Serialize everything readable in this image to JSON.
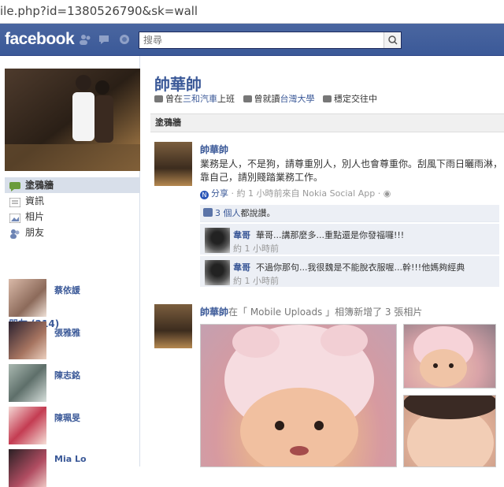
{
  "browser": {
    "url": "ile.php?id=1380526790&sk=wall"
  },
  "topbar": {
    "logo": "facebook",
    "search_placeholder": "搜尋",
    "search_value": "搜尋"
  },
  "left": {
    "nav": [
      {
        "label": "塗鴉牆",
        "icon": "wall-icon",
        "selected": true
      },
      {
        "label": "資訊",
        "icon": "info-icon",
        "selected": false
      },
      {
        "label": "相片",
        "icon": "photos-icon",
        "selected": false
      },
      {
        "label": "朋友",
        "icon": "friends-icon",
        "selected": false
      }
    ],
    "friends_heading": "朋友 (214)",
    "friends": [
      {
        "name": "蔡依諼"
      },
      {
        "name": "張雅雅"
      },
      {
        "name": "陳志銘"
      },
      {
        "name": "陳珮旻"
      },
      {
        "name": "Mia Lo"
      }
    ]
  },
  "profile": {
    "name": "帥華帥",
    "work_prefix": "曾在",
    "work_place": "三和汽車",
    "work_suffix": "上班",
    "school_prefix": "曾就讀",
    "school": "台灣大學",
    "relationship": "穩定交往中"
  },
  "wall_tab": "塗鴉牆",
  "post1": {
    "author": "帥華帥",
    "text": "業務是人，不是狗，請尊重別人，別人也會尊重你。刮風下雨日曬雨淋，靠自己，請別賤踏業務工作。",
    "share": "分享",
    "meta": "· 約 1 小時前來自 Nokia Social App ·",
    "likes_count": "3 個人",
    "likes_suffix": "都說讚。",
    "comments": [
      {
        "author": "韋哥",
        "text": "華哥...講那麼多...重點還是你發福囉!!!",
        "time": "約 1 小時前"
      },
      {
        "author": "韋哥",
        "text": "不過你那句...我很魏是不能脫衣服喔...幹!!!他媽夠經典",
        "time": "約 1 小時前"
      }
    ]
  },
  "post2": {
    "author": "帥華帥",
    "in": "在「 Mobile Uploads 」相簿新增了 3 張相片"
  }
}
